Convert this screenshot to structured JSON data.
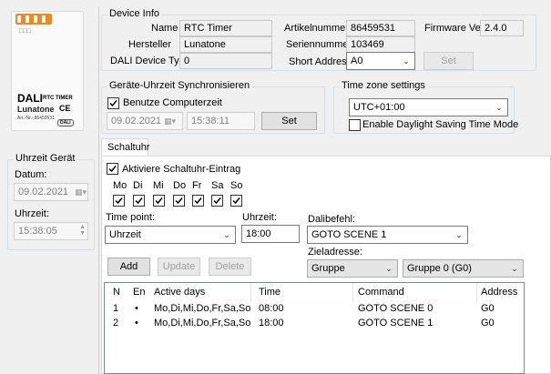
{
  "device_info": {
    "legend": "Device Info",
    "name_label": "Name",
    "name_value": "RTC Timer",
    "hersteller_label": "Hersteller",
    "hersteller_value": "Lunatone",
    "dali_type_label": "DALI Device Type",
    "dali_type_value": "0",
    "artikel_label": "Artikelnummer",
    "artikel_value": "86459531",
    "serien_label": "Seriennummer",
    "serien_value": "103469",
    "short_label": "Short Address",
    "short_value": "A0",
    "firmware_label": "Firmware Ver",
    "firmware_value": "2.4.0",
    "set_label": "Set"
  },
  "product": {
    "brand": "DALI",
    "model": "RTC TIMER",
    "maker": "Lunatone",
    "ce": "CE",
    "art_nr": "Art.-Nr.: 86459531",
    "dali_mark": "DALI"
  },
  "sync": {
    "legend": "Geräte-Uhrzeit Synchronisieren",
    "use_pc_label": "Benutze Computerzeit",
    "use_pc_checked": true,
    "date": "09.02.2021",
    "time": "15:38:11",
    "set_label": "Set"
  },
  "timezone": {
    "legend": "Time zone settings",
    "value": "UTC+01:00",
    "dst_label": "Enable Daylight Saving Time Mode",
    "dst_checked": false
  },
  "uhrzeit_geraet": {
    "legend": "Uhrzeit Gerät",
    "datum_label": "Datum:",
    "datum_value": "09.02.2021",
    "uhrzeit_label": "Uhrzeit:",
    "uhrzeit_value": "15:38:05"
  },
  "schaltuhr": {
    "tab_label": "Schaltuhr",
    "activate_label": "Aktiviere Schaltuhr-Eintrag",
    "activate_checked": true,
    "days": [
      {
        "label": "Mo",
        "checked": true
      },
      {
        "label": "Di",
        "checked": true
      },
      {
        "label": "Mi",
        "checked": true
      },
      {
        "label": "Do",
        "checked": true
      },
      {
        "label": "Fr",
        "checked": true
      },
      {
        "label": "Sa",
        "checked": true
      },
      {
        "label": "So",
        "checked": true
      }
    ],
    "time_point_label": "Time point:",
    "time_point_value": "Uhrzeit",
    "uhrzeit_label": "Uhrzeit:",
    "uhrzeit_value": "18:00",
    "dalibefehl_label": "Dalibefehl:",
    "dalibefehl_value": "GOTO SCENE 1",
    "zieladresse_label": "Zieladresse:",
    "ziel_type_value": "Gruppe",
    "ziel_group_value": "Gruppe 0 (G0)",
    "add_label": "Add",
    "update_label": "Update",
    "delete_label": "Delete",
    "columns": [
      "N",
      "En",
      "Active days",
      "Time",
      "Command",
      "Address"
    ],
    "rows": [
      {
        "n": "1",
        "en": "•",
        "days": "Mo,Di,Mi,Do,Fr,Sa,So",
        "time": "08:00",
        "command": "GOTO SCENE 0",
        "address": "G0"
      },
      {
        "n": "2",
        "en": "•",
        "days": "Mo,Di,Mi,Do,Fr,Sa,So",
        "time": "18:00",
        "command": "GOTO SCENE 1",
        "address": "G0"
      }
    ]
  }
}
